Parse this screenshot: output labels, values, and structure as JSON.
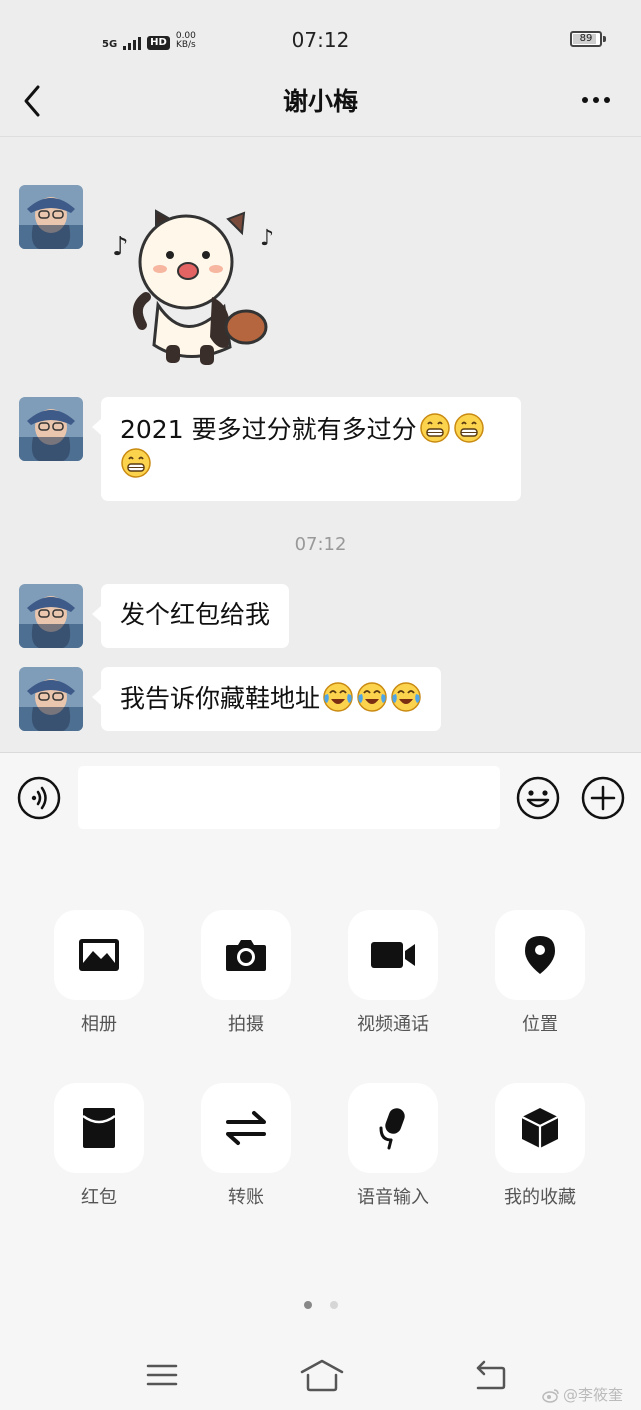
{
  "status_bar": {
    "network": "5G",
    "hd": "HD",
    "speed_value": "0.00",
    "speed_unit": "KB/s",
    "time": "07:12",
    "battery": "89",
    "battery_level": 0.89
  },
  "header": {
    "title": "谢小梅"
  },
  "messages": [
    {
      "type": "sticker",
      "sticker_icon": "panda-sticker"
    },
    {
      "type": "text",
      "text": "2021 要多过分就有多过分",
      "emojis": [
        "grin-emoji",
        "grin-emoji",
        "grin-emoji"
      ]
    },
    {
      "type": "time",
      "text": "07:12"
    },
    {
      "type": "text",
      "text": "发个红包给我"
    },
    {
      "type": "text",
      "text": "我告诉你藏鞋地址",
      "emojis": [
        "tears-of-joy-emoji",
        "tears-of-joy-emoji",
        "tears-of-joy-emoji"
      ]
    }
  ],
  "input_bar": {
    "value": "",
    "placeholder": ""
  },
  "panel": {
    "items": [
      {
        "label": "相册",
        "icon": "photo-album-icon"
      },
      {
        "label": "拍摄",
        "icon": "camera-icon"
      },
      {
        "label": "视频通话",
        "icon": "video-call-icon"
      },
      {
        "label": "位置",
        "icon": "location-icon"
      },
      {
        "label": "红包",
        "icon": "red-packet-icon"
      },
      {
        "label": "转账",
        "icon": "transfer-icon"
      },
      {
        "label": "语音输入",
        "icon": "microphone-icon"
      },
      {
        "label": "我的收藏",
        "icon": "favorites-cube-icon"
      }
    ],
    "page_count": 2,
    "current_page": 1
  },
  "watermark": "@李筱奎",
  "colors": {
    "background": "#ededed",
    "bubble": "#ffffff",
    "panel": "#f6f6f6"
  }
}
